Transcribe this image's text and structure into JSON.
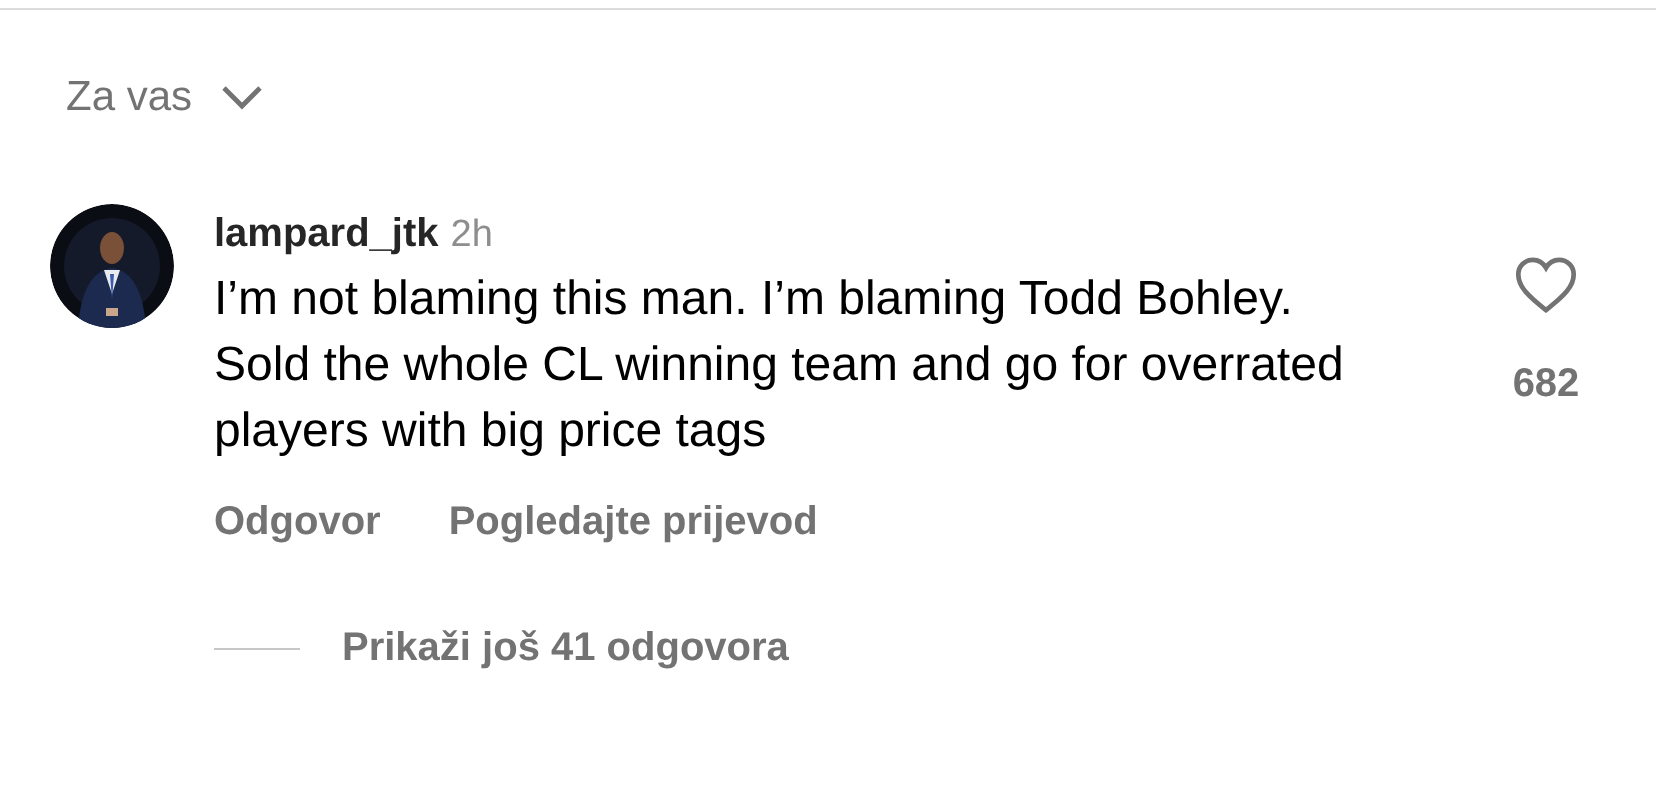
{
  "sort_menu": {
    "label": "Za vas",
    "expanded": false
  },
  "comment": {
    "username": "lampard_jtk",
    "time": "2h",
    "text": "I’m not blaming this man. I’m blaming Todd Bohley. Sold the whole CL winning team and go for overrated players with big price tags",
    "liked": false,
    "like_count": "682",
    "actions": [
      "Odgovor",
      "Pogledajte prijevod"
    ],
    "more_replies": "Prikaži još 41 odgovora"
  }
}
